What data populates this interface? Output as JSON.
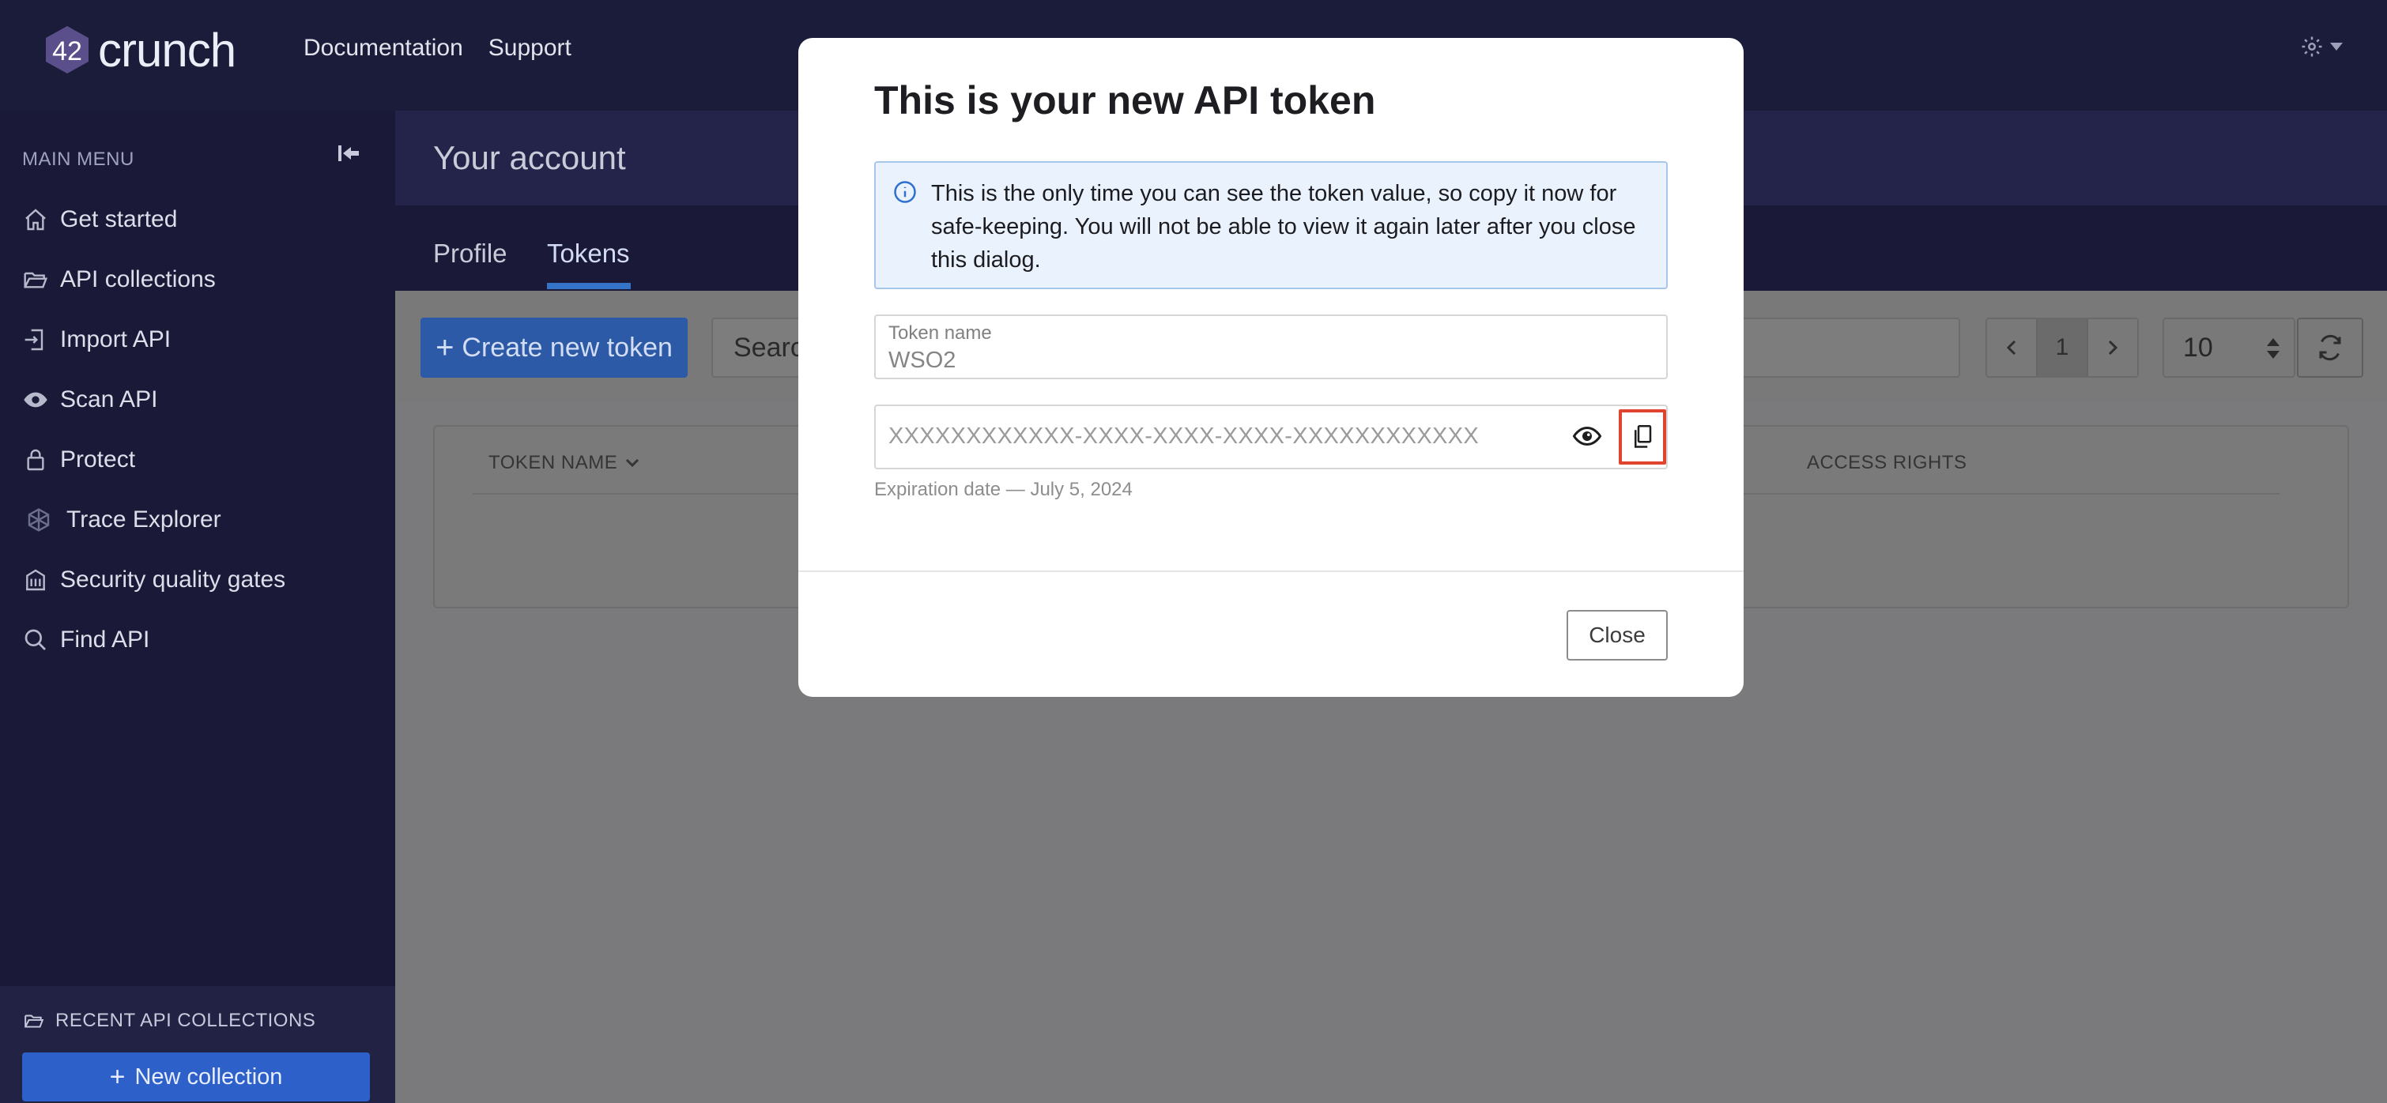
{
  "topbar": {
    "logo_number": "42",
    "logo_word": "crunch",
    "nav": [
      "Documentation",
      "Support"
    ],
    "settings_icon": "gear-icon"
  },
  "sidebar": {
    "menu_label": "MAIN MENU",
    "items": [
      {
        "label": "Get started",
        "icon": "home-icon"
      },
      {
        "label": "API collections",
        "icon": "folder-open-icon"
      },
      {
        "label": "Import API",
        "icon": "import-icon"
      },
      {
        "label": "Scan API",
        "icon": "eye-icon"
      },
      {
        "label": "Protect",
        "icon": "lock-icon"
      },
      {
        "label": "Trace Explorer",
        "icon": "hexagon-icon"
      },
      {
        "label": "Security quality gates",
        "icon": "building-icon"
      },
      {
        "label": "Find API",
        "icon": "search-icon"
      }
    ],
    "recent_label": "RECENT API COLLECTIONS",
    "new_collection": "New collection"
  },
  "main": {
    "page_title": "Your account",
    "tabs": [
      "Profile",
      "Tokens"
    ],
    "active_tab": "Tokens",
    "create_button": "Create new token",
    "search_placeholder": "Search",
    "page_number": "1",
    "per_page": "10",
    "columns": [
      "TOKEN NAME",
      "ACCESS RIGHTS"
    ]
  },
  "modal": {
    "title": "This is your new API token",
    "alert": "This is the only time you can see the token value, so copy it now for safe-keeping. You will not be able to view it again later after you close this dialog.",
    "token_name_label": "Token name",
    "token_name_value": "WSO2",
    "token_value": "XXXXXXXXXXXX-XXXX-XXXX-XXXX-XXXXXXXXXXXX",
    "expiry": "Expiration date — July 5, 2024",
    "close_button": "Close"
  },
  "colors": {
    "brand_dark": "#1b1b3a",
    "primary": "#2d60c8",
    "highlight": "#e0442e"
  }
}
